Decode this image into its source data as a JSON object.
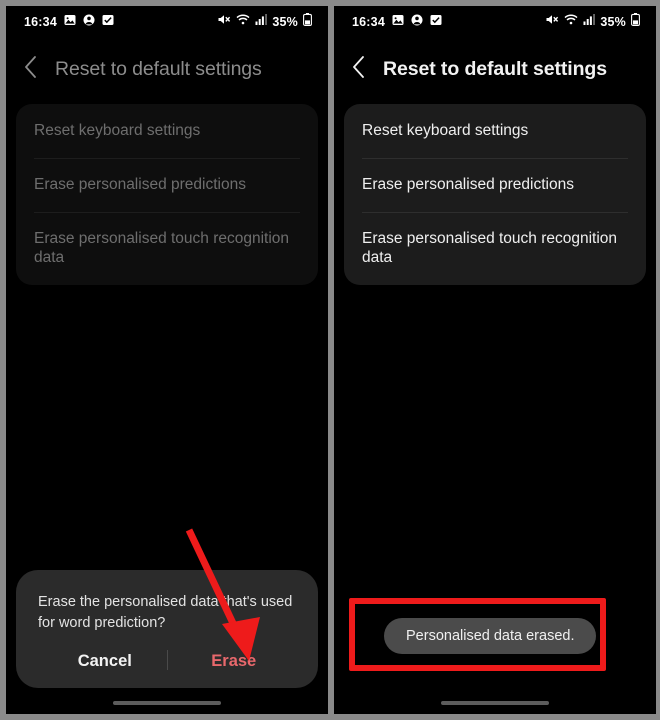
{
  "status_bar": {
    "time": "16:34",
    "battery": "35%",
    "left_icons": [
      "image-icon",
      "person-icon",
      "checkbox-icon"
    ],
    "right_icons": [
      "mute-icon",
      "wifi-icon",
      "signal-icon",
      "battery-icon"
    ]
  },
  "left_panel": {
    "header": {
      "back_icon": "back-chevron-icon",
      "title": "Reset to default settings"
    },
    "list": [
      {
        "label": "Reset keyboard settings"
      },
      {
        "label": "Erase personalised predictions"
      },
      {
        "label": "Erase personalised touch recognition data"
      }
    ],
    "dialog": {
      "message": "Erase the personalised data that's used for word prediction?",
      "cancel_label": "Cancel",
      "confirm_label": "Erase",
      "confirm_color": "#e8686c"
    },
    "annotation": {
      "arrow_color": "#ee1b1b",
      "points_at": "Erase"
    }
  },
  "right_panel": {
    "header": {
      "back_icon": "back-chevron-icon",
      "title": "Reset to default settings"
    },
    "list": [
      {
        "label": "Reset keyboard settings"
      },
      {
        "label": "Erase personalised predictions"
      },
      {
        "label": "Erase personalised touch recognition data"
      }
    ],
    "toast": {
      "message": "Personalised data erased."
    },
    "annotation": {
      "highlight_color": "#ee1b1b",
      "highlights": "toast"
    }
  },
  "colors": {
    "page_background": "#8a8a8a",
    "screen_background": "#000000",
    "card_dim": "#0e0e0e",
    "card_bright": "#1c1c1c",
    "dialog_background": "#2b2b2b",
    "toast_background": "#4b4b4b",
    "accent_red": "#ee1b1b"
  }
}
